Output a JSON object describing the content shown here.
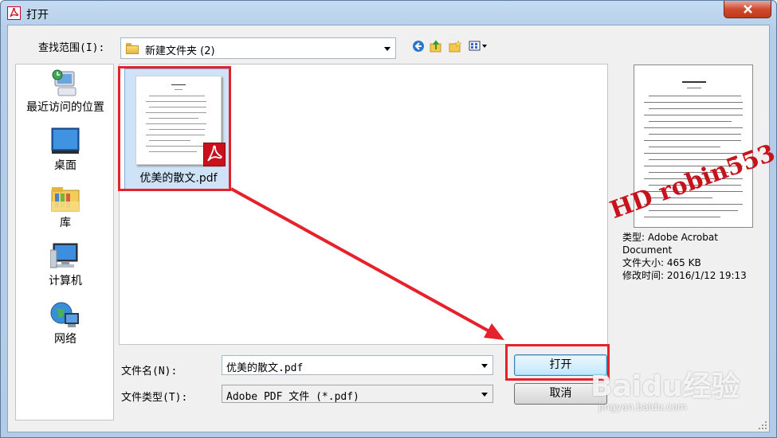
{
  "window": {
    "title": "打开",
    "close_label": "×"
  },
  "lookin": {
    "label": "查找范围(I):",
    "value": "新建文件夹 (2)"
  },
  "nav": {
    "back_icon": "back-icon",
    "up_icon": "up-folder-icon",
    "new_folder_icon": "new-folder-icon",
    "view_icon": "view-menu-icon"
  },
  "places": [
    {
      "label": "最近访问的位置",
      "icon": "recent-places-icon"
    },
    {
      "label": "桌面",
      "icon": "desktop-icon"
    },
    {
      "label": "库",
      "icon": "libraries-icon"
    },
    {
      "label": "计算机",
      "icon": "computer-icon"
    },
    {
      "label": "网络",
      "icon": "network-icon"
    }
  ],
  "files": [
    {
      "name": "优美的散文.pdf",
      "icon": "pdf-file-icon",
      "selected": true
    }
  ],
  "form": {
    "filename_label": "文件名(N):",
    "filename_value": "优美的散文.pdf",
    "filetype_label": "文件类型(T):",
    "filetype_value": "Adobe PDF 文件 (*.pdf)"
  },
  "buttons": {
    "open": "打开",
    "cancel": "取消"
  },
  "preview": {
    "type_label": "类型:",
    "type_value": "Adobe Acrobat Document",
    "size_label": "文件大小:",
    "size_value": "465 KB",
    "modified_label": "修改时间:",
    "modified_value": "2016/1/12 19:13"
  },
  "watermark": "HD robin553",
  "baidu_watermark": {
    "logo": "Baidu经验",
    "url": "jingyan.baidu.com"
  },
  "colors": {
    "annotation": "#e5222b",
    "selection": "#cfe3f8",
    "titlebar": "#c5dbf2"
  }
}
